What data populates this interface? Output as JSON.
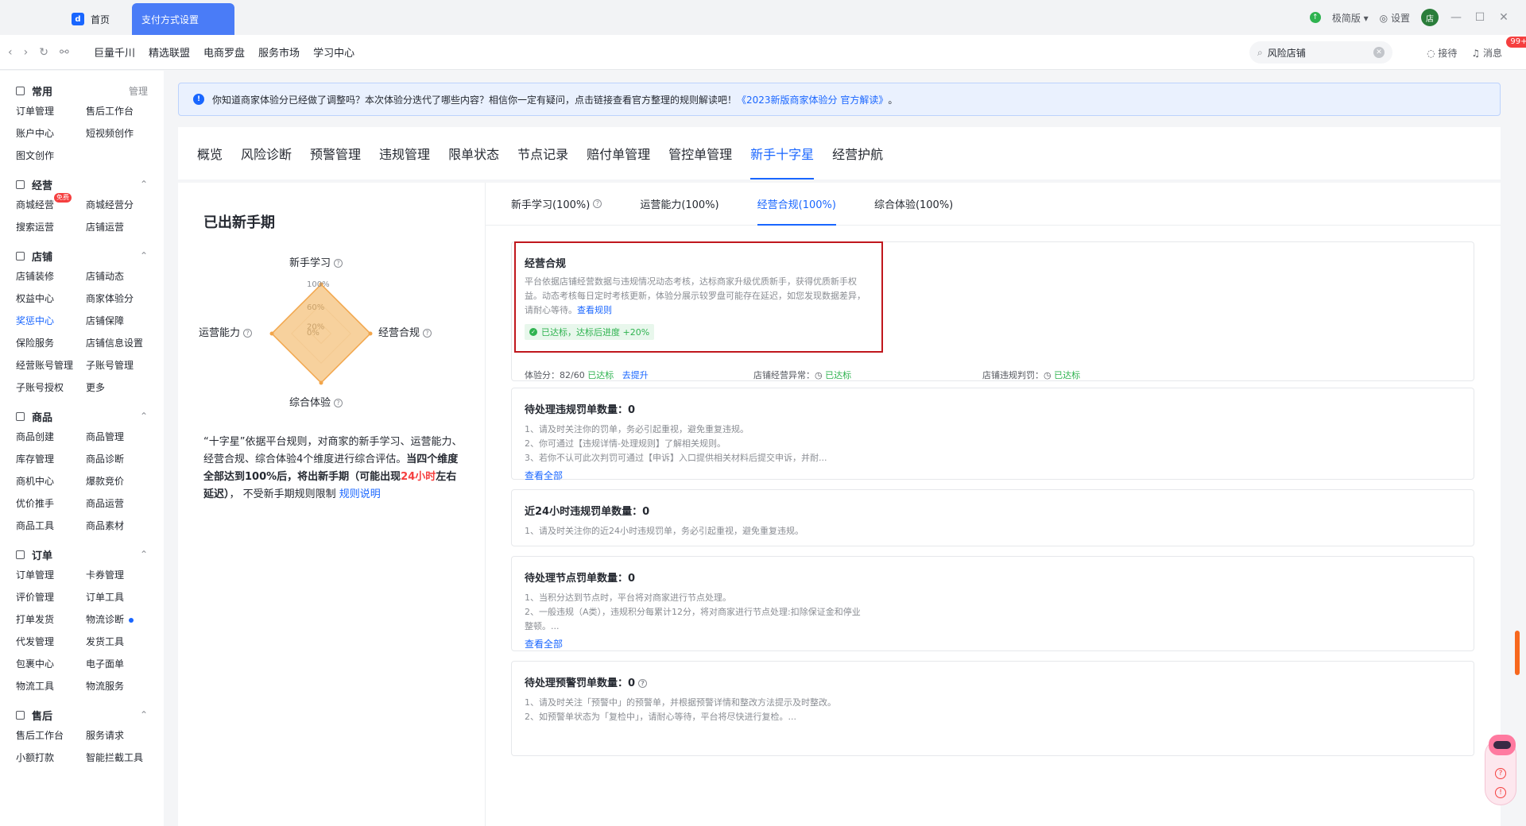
{
  "tabs": {
    "home": "首页",
    "active": "支付方式设置"
  },
  "topbar": {
    "edition": "极简版",
    "settings": "设置",
    "avatar_text": "店"
  },
  "nav": {
    "links": [
      "巨量千川",
      "精选联盟",
      "电商罗盘",
      "服务市场",
      "学习中心"
    ],
    "search_value": "风险店铺",
    "reception": "接待",
    "messages": "消息",
    "msg_badge": "99+"
  },
  "sidebar": [
    {
      "title": "常用",
      "right": "管理",
      "items": [
        "订单管理",
        "售后工作台",
        "账户中心",
        "短视频创作",
        "图文创作"
      ]
    },
    {
      "title": "经营",
      "right": "⌃",
      "items": [
        "商城经营",
        "商城经营分",
        "搜索运营",
        "店铺运营"
      ],
      "new_tag": "免费"
    },
    {
      "title": "店铺",
      "right": "⌃",
      "items": [
        "店铺装修",
        "店铺动态",
        "权益中心",
        "商家体验分",
        "奖惩中心",
        "店铺保障",
        "保险服务",
        "店铺信息设置",
        "经营账号管理",
        "子账号管理",
        "子账号授权",
        "更多"
      ]
    },
    {
      "title": "商品",
      "right": "⌃",
      "items": [
        "商品创建",
        "商品管理",
        "库存管理",
        "商品诊断",
        "商机中心",
        "爆款竞价",
        "优价推手",
        "商品运营",
        "商品工具",
        "商品素材"
      ]
    },
    {
      "title": "订单",
      "right": "⌃",
      "items": [
        "订单管理",
        "卡券管理",
        "评价管理",
        "订单工具",
        "打单发货",
        "物流诊断",
        "代发管理",
        "发货工具",
        "包裹中心",
        "电子面单",
        "物流工具",
        "物流服务"
      ]
    },
    {
      "title": "售后",
      "right": "⌃",
      "items": [
        "售后工作台",
        "服务请求",
        "小额打款",
        "智能拦截工具"
      ]
    }
  ],
  "notice": {
    "text": "你知道商家体验分已经做了调整吗？本次体验分迭代了哪些内容？相信你一定有疑问，点击链接查看官方整理的规则解读吧！",
    "link": "《2023新版商家体验分 官方解读》",
    "tail": "。"
  },
  "main_tabs": [
    "概览",
    "风险诊断",
    "预警管理",
    "违规管理",
    "限单状态",
    "节点记录",
    "赔付单管理",
    "管控单管理",
    "新手十字星",
    "经营护航"
  ],
  "left": {
    "title": "已出新手期",
    "radar": {
      "top": "新手学习",
      "right": "经营合规",
      "bottom": "综合体验",
      "left": "运营能力",
      "ticks": [
        "100%",
        "60%",
        "20%",
        "0%"
      ],
      "values": [
        1.0,
        1.0,
        1.0,
        1.0
      ]
    },
    "desc_a": "“十字星”依据平台规则，对商家的新手学习、运营能力、经营合规、综合体验4个维度进行综合评估。",
    "desc_b": "当四个维度全部达到100%后，将出新手期（可能出现",
    "desc_red": "24小时",
    "desc_c": "左右延迟）",
    "desc_d": "， 不受新手期规则限制",
    "desc_link": "规则说明"
  },
  "sub_tabs": [
    "新手学习(100%)",
    "运营能力(100%)",
    "经营合规(100%)",
    "综合体验(100%)"
  ],
  "compliance": {
    "title": "经营合规",
    "text": "平台依据店铺经营数据与违规情况动态考核，达标商家升级优质新手，获得优质新手权益。动态考核每日定时考核更新，体验分展示较罗盘可能存在延迟，如您发现数据差异，请耐心等待。",
    "link": "查看规则",
    "tag": "已达标，达标后进度 +20%",
    "score_label": "体验分：",
    "score_value": "82/60",
    "score_status": "已达标",
    "score_link": "去提升",
    "abn_label": "店铺经营异常：",
    "abn_status": "已达标",
    "pen_label": "店铺违规判罚：",
    "pen_status": "已达标"
  },
  "boxes": [
    {
      "title": "待处理违规罚单数量：0",
      "lines": [
        "1、请及时关注你的罚单，务必引起重视，避免重复违规。",
        "2、你可通过【违规详情-处理规则】了解相关规则。",
        "3、若你不认可此次判罚可通过【申诉】入口提供相关材料后提交申诉，并耐..."
      ],
      "link": "查看全部"
    },
    {
      "title": "近24小时违规罚单数量：0",
      "lines": [
        "1、请及时关注你的近24小时违规罚单，务必引起重视，避免重复违规。"
      ],
      "link": ""
    },
    {
      "title": "待处理节点罚单数量：0",
      "lines": [
        "1、当积分达到节点时，平台将对商家进行节点处理。",
        "2、一般违规（A类），违规积分每累计12分，将对商家进行节点处理:扣除保证金和停业整顿。..."
      ],
      "link": "查看全部"
    },
    {
      "title": "待处理预警罚单数量：0",
      "lines": [
        "1、请及时关注「预警中」的预警单，并根据预警详情和整改方法提示及时整改。",
        "2、如预警单状态为「复检中」，请耐心等待，平台将尽快进行复检。..."
      ],
      "link": ""
    }
  ]
}
